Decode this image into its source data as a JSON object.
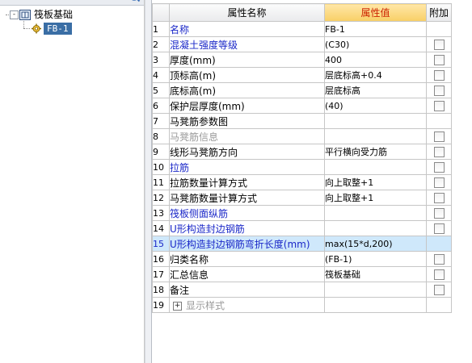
{
  "tree": {
    "root": {
      "label": "筏板基础",
      "expander": "-",
      "icon": "slab-foundation-icon"
    },
    "child": {
      "label": "FB-1",
      "icon": "component-gear-icon"
    }
  },
  "table": {
    "headers": {
      "name": "属性名称",
      "value": "属性值",
      "extra": "附加"
    },
    "rows": [
      {
        "idx": "1",
        "name": "名称",
        "value": "FB-1",
        "checkbox": false,
        "style": "blue",
        "expander": ""
      },
      {
        "idx": "2",
        "name": "混凝土强度等级",
        "value": "(C30)",
        "checkbox": true,
        "style": "blue",
        "expander": ""
      },
      {
        "idx": "3",
        "name": "厚度(mm)",
        "value": "400",
        "checkbox": true,
        "style": "",
        "expander": ""
      },
      {
        "idx": "4",
        "name": "顶标高(m)",
        "value": "层底标高+0.4",
        "checkbox": true,
        "style": "",
        "expander": ""
      },
      {
        "idx": "5",
        "name": "底标高(m)",
        "value": "层底标高",
        "checkbox": true,
        "style": "",
        "expander": ""
      },
      {
        "idx": "6",
        "name": "保护层厚度(mm)",
        "value": "(40)",
        "checkbox": true,
        "style": "",
        "expander": ""
      },
      {
        "idx": "7",
        "name": "马凳筋参数图",
        "value": "",
        "checkbox": false,
        "style": "",
        "expander": ""
      },
      {
        "idx": "8",
        "name": "马凳筋信息",
        "value": "",
        "checkbox": true,
        "style": "gray",
        "expander": ""
      },
      {
        "idx": "9",
        "name": "线形马凳筋方向",
        "value": "平行横向受力筋",
        "checkbox": true,
        "style": "",
        "expander": ""
      },
      {
        "idx": "10",
        "name": "拉筋",
        "value": "",
        "checkbox": true,
        "style": "blue",
        "expander": ""
      },
      {
        "idx": "11",
        "name": "拉筋数量计算方式",
        "value": "向上取整+1",
        "checkbox": true,
        "style": "",
        "expander": ""
      },
      {
        "idx": "12",
        "name": "马凳筋数量计算方式",
        "value": "向上取整+1",
        "checkbox": true,
        "style": "",
        "expander": ""
      },
      {
        "idx": "13",
        "name": "筏板侧面纵筋",
        "value": "",
        "checkbox": true,
        "style": "blue",
        "expander": ""
      },
      {
        "idx": "14",
        "name": "U形构造封边钢筋",
        "value": "",
        "checkbox": true,
        "style": "blue",
        "expander": ""
      },
      {
        "idx": "15",
        "name": "U形构造封边钢筋弯折长度(mm)",
        "value": "max(15*d,200)",
        "checkbox": false,
        "style": "selected",
        "expander": ""
      },
      {
        "idx": "16",
        "name": "归类名称",
        "value": "(FB-1)",
        "checkbox": true,
        "style": "",
        "expander": ""
      },
      {
        "idx": "17",
        "name": "汇总信息",
        "value": "筏板基础",
        "checkbox": true,
        "style": "",
        "expander": ""
      },
      {
        "idx": "18",
        "name": "备注",
        "value": "",
        "checkbox": true,
        "style": "",
        "expander": ""
      },
      {
        "idx": "19",
        "name": "显示样式",
        "value": "",
        "checkbox": false,
        "style": "gray",
        "expander": "+"
      }
    ]
  },
  "colors": {
    "accent_blue": "#1a27c8",
    "selection": "#cfe8fb",
    "tree_selection": "#3a6ea5",
    "header_highlight": "#f8cf66"
  }
}
